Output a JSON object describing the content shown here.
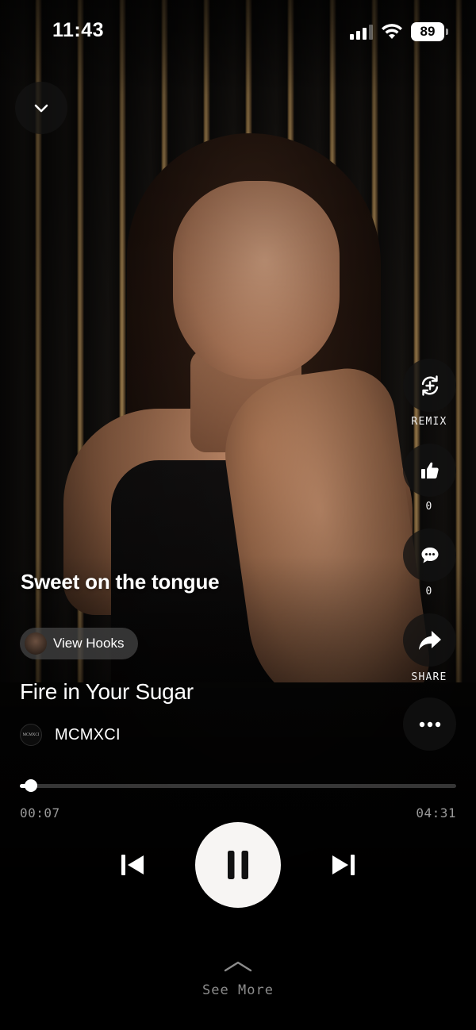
{
  "status_bar": {
    "time": "11:43",
    "battery": "89"
  },
  "actions": {
    "remix_label": "REMIX",
    "like_count": "0",
    "comment_count": "0",
    "share_label": "SHARE"
  },
  "now_playing": {
    "lyric_line": "Sweet on the tongue",
    "view_hooks_label": "View Hooks",
    "track_title": "Fire in Your Sugar",
    "artist_name": "MCMXCI",
    "artist_avatar_text": "MCMXCI",
    "elapsed": "00:07",
    "duration": "04:31",
    "progress_fraction": 0.026
  },
  "footer": {
    "see_more_label": "See More"
  },
  "colors": {
    "accent": "#ffffff",
    "button_bg": "#121212",
    "play_button_bg": "#f7f5f3"
  },
  "icons": {
    "collapse": "chevron-down-icon",
    "remix": "remix-icon",
    "like": "thumbs-up-icon",
    "comment": "comment-icon",
    "share": "share-arrow-icon",
    "more": "more-horizontal-icon",
    "prev": "skip-previous-icon",
    "pause": "pause-icon",
    "next": "skip-next-icon",
    "see_more": "chevron-up-icon"
  }
}
